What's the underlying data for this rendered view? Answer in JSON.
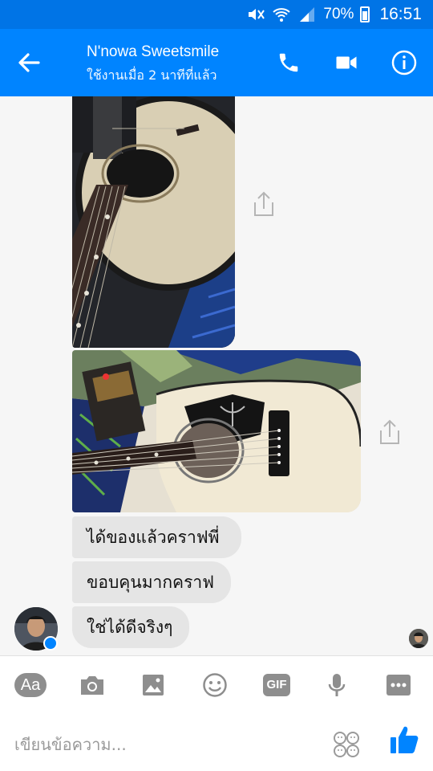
{
  "status_bar": {
    "battery": "70%",
    "time": "16:51",
    "icons": [
      "mute-icon",
      "wifi-icon",
      "signal-icon",
      "battery-icon"
    ]
  },
  "header": {
    "contact_name": "N'nowa Sweetsmile",
    "contact_status": "ใช้งานเมื่อ 2 นาทีที่แล้ว",
    "icons": [
      "back-arrow-icon",
      "phone-icon",
      "video-camera-icon",
      "info-icon"
    ]
  },
  "messages": [
    {
      "type": "image",
      "description_icon": "guitar-photo"
    },
    {
      "type": "image",
      "description_icon": "guitar-photo"
    },
    {
      "type": "text",
      "text": "ได้ของแล้วคราฟพี่"
    },
    {
      "type": "text",
      "text": "ขอบคุนมากคราฟ"
    },
    {
      "type": "text",
      "text": "ใช่ได้ดีจริงๆ"
    }
  ],
  "composer": {
    "aa_label": "Aa",
    "gif_label": "GIF",
    "placeholder": "เขียนข้อความ...",
    "icons": [
      "camera-icon",
      "gallery-icon",
      "emoji-icon",
      "microphone-icon",
      "more-icon",
      "sticker-icon",
      "thumbs-up-icon"
    ]
  },
  "colors": {
    "header_blue": "#0084ff",
    "status_blue": "#0074e6",
    "bubble_gray": "#e5e5e5",
    "icon_gray": "#8e8e8e"
  }
}
